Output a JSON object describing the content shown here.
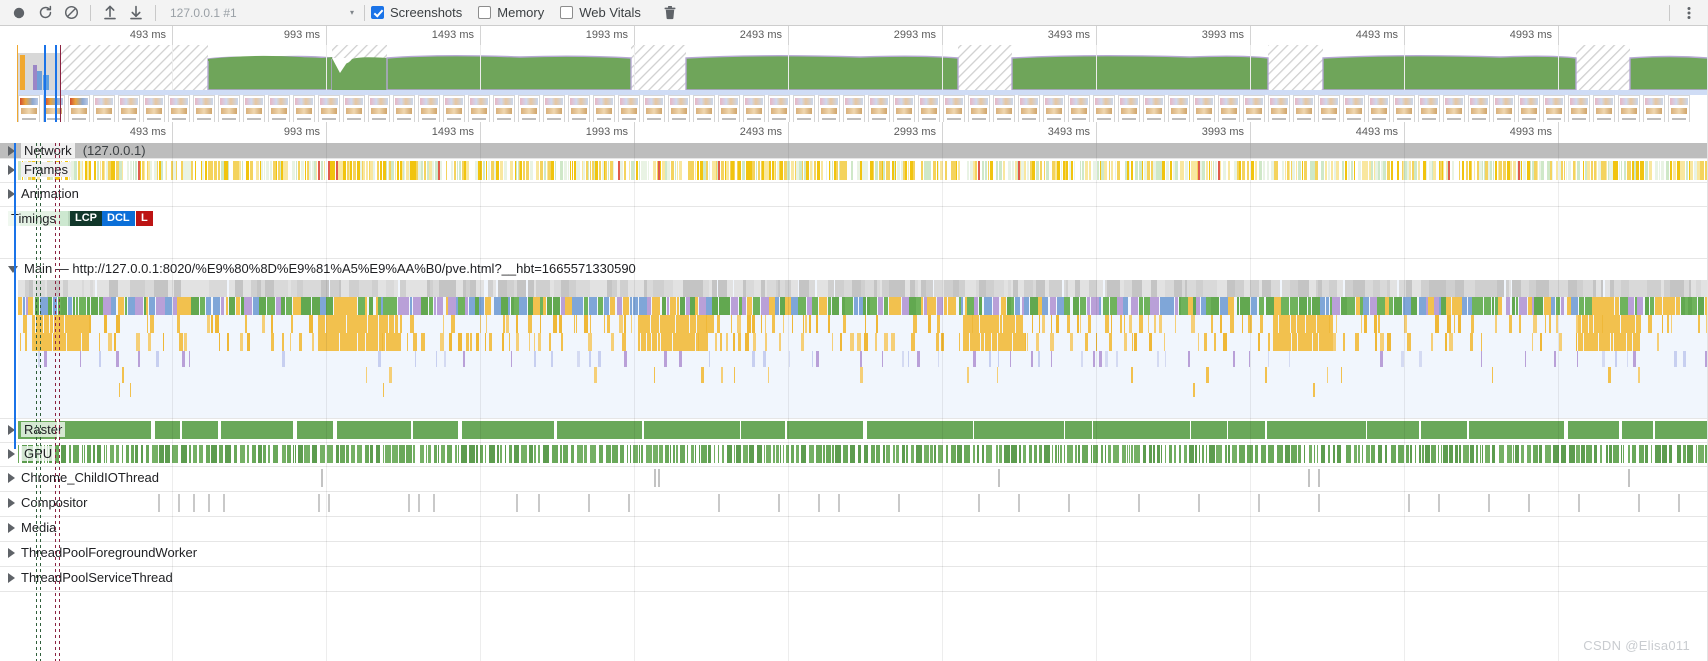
{
  "toolbar": {
    "record_icon": "record-circle-icon",
    "reload_icon": "reload-icon",
    "clear_icon": "clear-prohibited-icon",
    "upload_icon": "upload-arrow-icon",
    "download_icon": "download-arrow-icon",
    "profile_select_value": "127.0.0.1 #1",
    "caret": "▾",
    "screenshots_label": "Screenshots",
    "screenshots_checked": true,
    "memory_label": "Memory",
    "memory_checked": false,
    "web_vitals_label": "Web Vitals",
    "web_vitals_checked": false,
    "trash_icon": "trash-icon",
    "accent_color": "#1a73e8"
  },
  "overview": {
    "ruler_labels": [
      "493 ms",
      "993 ms",
      "1493 ms",
      "1993 ms",
      "2493 ms",
      "2993 ms",
      "3493 ms",
      "3993 ms",
      "4493 ms",
      "4993 ms"
    ],
    "cpu_color": "#6fa55a",
    "idle_pattern": "diagonal-hatch"
  },
  "timeline_ruler": {
    "labels": [
      "493 ms",
      "993 ms",
      "1493 ms",
      "1993 ms",
      "2493 ms",
      "2993 ms",
      "3493 ms",
      "3993 ms",
      "4493 ms",
      "4993 ms"
    ]
  },
  "tracks": [
    {
      "name": "Network",
      "sublabel": "(127.0.0.1)",
      "expanded": false
    },
    {
      "name": "Frames",
      "sublabel": "",
      "expanded": false
    },
    {
      "name": "Animation",
      "sublabel": "",
      "expanded": false
    },
    {
      "name": "Timings",
      "sublabel": "",
      "expanded": false
    },
    {
      "name": "Main",
      "sublabel": "— http://127.0.0.1:8020/%E9%80%8D%E9%81%A5%E9%AA%B0/pve.html?__hbt=1665571330590",
      "expanded": true
    },
    {
      "name": "Raster",
      "sublabel": "",
      "expanded": false
    },
    {
      "name": "GPU",
      "sublabel": "",
      "expanded": false
    },
    {
      "name": "Chrome_ChildIOThread",
      "sublabel": "",
      "expanded": false
    },
    {
      "name": "Compositor",
      "sublabel": "",
      "expanded": false
    },
    {
      "name": "Media",
      "sublabel": "",
      "expanded": false
    },
    {
      "name": "ThreadPoolForegroundWorker",
      "sublabel": "",
      "expanded": false
    },
    {
      "name": "ThreadPoolServiceThread",
      "sublabel": "",
      "expanded": false
    }
  ],
  "timings_badges": [
    {
      "label": "LCP",
      "bg": "#11372a",
      "fg": "#ffffff"
    },
    {
      "label": "DCL",
      "bg": "#0b6fd8",
      "fg": "#ffffff"
    },
    {
      "label": "L",
      "bg": "#bd1414",
      "fg": "#ffffff"
    }
  ],
  "main_track": {
    "url": "Main — http://127.0.0.1:8020/%E9%80%8D%E9%81%A5%E9%AA%B0/pve.html?__hbt=1665571330590"
  },
  "colors": {
    "scripting_yellow": "#f2c14e",
    "rendering_purple": "#b9a0d8",
    "painting_green": "#54a24b",
    "system_gray": "#bdbdbd",
    "loading_blue": "#7fa6d8",
    "idle_bg": "#f1f6fd"
  },
  "watermark": "CSDN @Elisa011"
}
